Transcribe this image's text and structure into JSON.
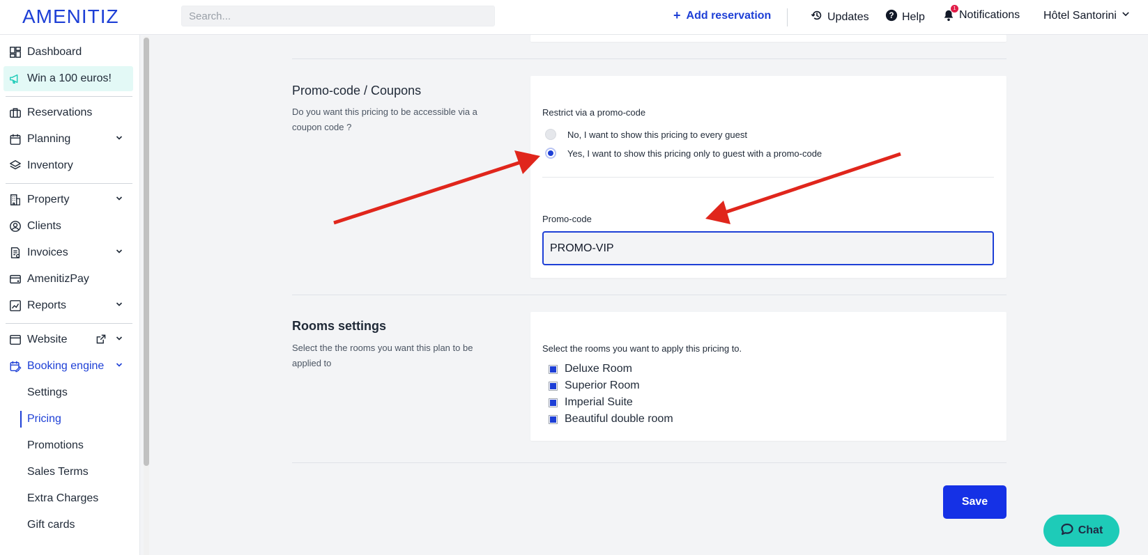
{
  "brand": {
    "logo": "AMENITIZ",
    "accent": "#1d3fd6",
    "arrow_color": "#e0261c"
  },
  "header": {
    "search_placeholder": "Search...",
    "add_reservation": "Add reservation",
    "updates": "Updates",
    "help": "Help",
    "notifications": "Notifications",
    "notifications_badge": "1",
    "hotel": "Hôtel Santorini"
  },
  "sidebar": {
    "dashboard": "Dashboard",
    "promo": "Win a 100 euros!",
    "reservations": "Reservations",
    "planning": "Planning",
    "inventory": "Inventory",
    "property": "Property",
    "clients": "Clients",
    "invoices": "Invoices",
    "amenitizpay": "AmenitizPay",
    "reports": "Reports",
    "website": "Website",
    "booking_engine": "Booking engine",
    "sub": {
      "settings": "Settings",
      "pricing": "Pricing",
      "promotions": "Promotions",
      "sales_terms": "Sales Terms",
      "extra_charges": "Extra Charges",
      "gift_cards": "Gift cards"
    }
  },
  "promo_section": {
    "title": "Promo-code / Coupons",
    "description": "Do you want this pricing to be accessible via a coupon code ?",
    "restrict_label": "Restrict via a promo-code",
    "option_no": "No, I want to show this pricing to every guest",
    "option_yes": "Yes, I want to show this pricing only to guest with a promo-code",
    "selected": "yes",
    "code_label": "Promo-code",
    "code_value": "PROMO-VIP"
  },
  "rooms_section": {
    "title": "Rooms settings",
    "description": "Select the the rooms you want this plan to be applied to",
    "select_label": "Select the rooms you want to apply this pricing to.",
    "rooms": [
      "Deluxe Room",
      "Superior Room",
      "Imperial Suite",
      "Beautiful double room"
    ]
  },
  "actions": {
    "save": "Save",
    "chat": "Chat"
  }
}
